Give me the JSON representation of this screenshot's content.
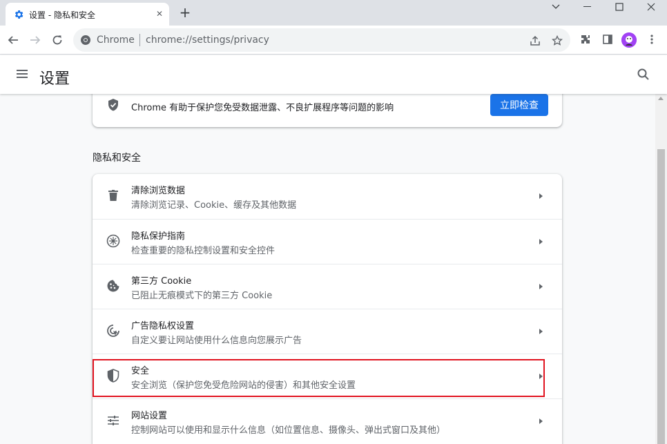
{
  "colors": {
    "accent": "#1a73e8",
    "highlight": "#e1131f"
  },
  "tab": {
    "title": "设置 - 隐私和安全",
    "close": "✕",
    "favicon": "gear-icon"
  },
  "new_tab": "+",
  "window": {
    "minimize": "⌄",
    "restore": "—",
    "maximize": "☐",
    "close": "✕"
  },
  "omnibox": {
    "brand": "Chrome",
    "url": "chrome://settings/privacy"
  },
  "settings": {
    "title": "设置"
  },
  "safety_check": {
    "text": "Chrome 有助于保护您免受数据泄露、不良扩展程序等问题的影响",
    "button": "立即检查"
  },
  "section": {
    "title": "隐私和安全"
  },
  "items": [
    {
      "icon": "trash-icon",
      "title": "清除浏览数据",
      "subtitle": "清除浏览记录、Cookie、缓存及其他数据"
    },
    {
      "icon": "privacy-guide-icon",
      "title": "隐私保护指南",
      "subtitle": "检查重要的隐私控制设置和安全控件"
    },
    {
      "icon": "cookie-icon",
      "title": "第三方 Cookie",
      "subtitle": "已阻止无痕模式下的第三方 Cookie"
    },
    {
      "icon": "ad-privacy-icon",
      "title": "广告隐私权设置",
      "subtitle": "自定义要让网站使用什么信息向您展示广告"
    },
    {
      "icon": "shield-icon",
      "title": "安全",
      "subtitle": "安全浏览（保护您免受危险网站的侵害）和其他安全设置",
      "highlighted": true
    },
    {
      "icon": "sliders-icon",
      "title": "网站设置",
      "subtitle": "控制网站可以使用和显示什么信息（如位置信息、摄像头、弹出式窗口及其他）"
    }
  ]
}
